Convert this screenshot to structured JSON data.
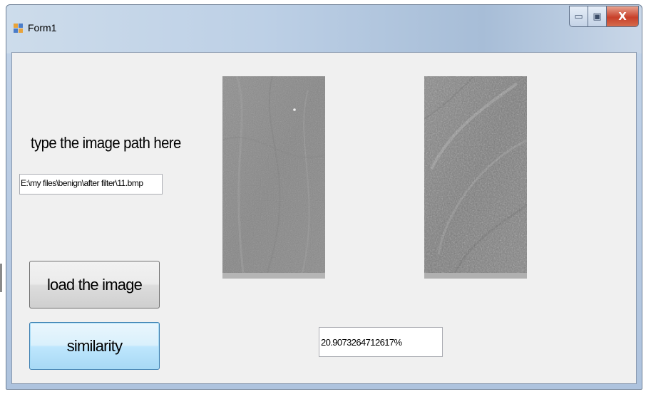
{
  "window": {
    "title": "Form1",
    "controls": {
      "minimize": "▭",
      "maximize": "▣",
      "close": "X"
    }
  },
  "form": {
    "path_label": "type the image path here",
    "path_value": "E:\\my files\\benign\\after filter\\11.bmp",
    "load_button": "load the image",
    "similarity_button": "similarity",
    "result_value": "20.9073264712617%"
  },
  "pictures": {
    "left_icon": "texture-image",
    "right_icon": "texture-image"
  },
  "colors": {
    "close_button": "#c8402a",
    "similarity_button_border": "#3c7fb1",
    "client_background": "#f0f0f0"
  }
}
